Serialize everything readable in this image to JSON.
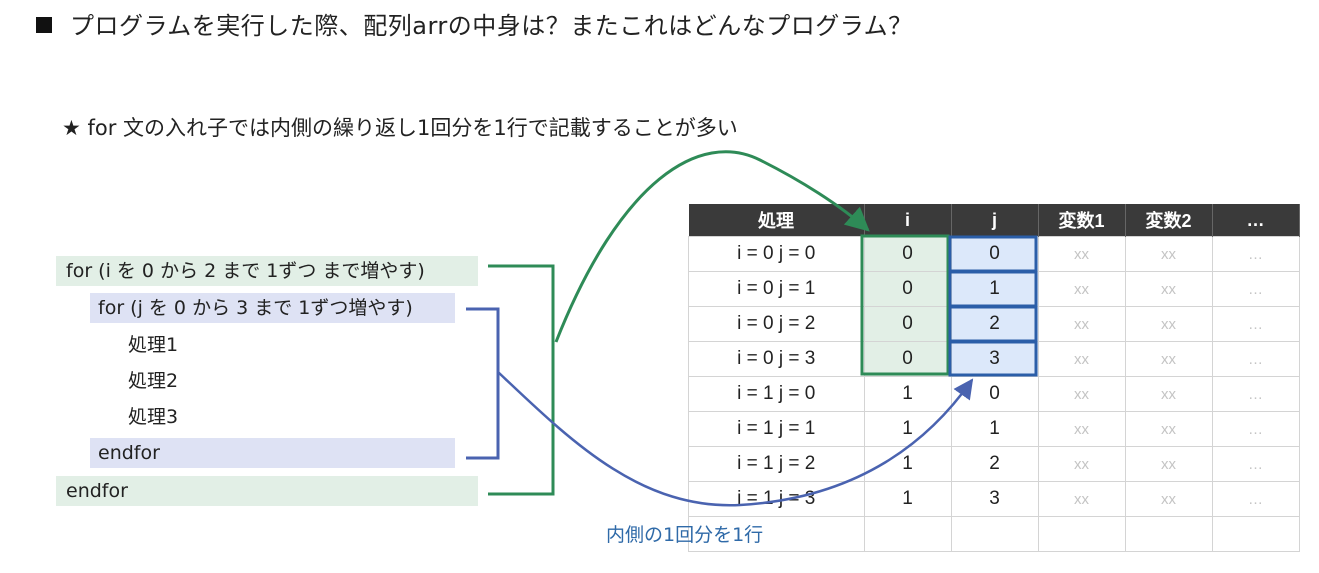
{
  "heading": "プログラムを実行した際、配列arrの中身は？またこれはどんなプログラム？",
  "note": "★ for 文の入れ子では内側の繰り返し1回分を1行で記載することが多い",
  "code": {
    "outer_for": "for (i を 0 から 2 まで 1ずつ まで増やす)",
    "inner_for": "for (j を 0 から 3 まで 1ずつ増やす)",
    "body": [
      "処理1",
      "処理2",
      "処理3"
    ],
    "inner_end": "endfor",
    "outer_end": "endfor"
  },
  "table": {
    "headers": [
      "処理",
      "i",
      "j",
      "変数1",
      "変数2",
      "…"
    ],
    "rows": [
      {
        "label": "i = 0 j = 0",
        "i": "0",
        "j": "0",
        "v1": "xx",
        "v2": "xx",
        "more": "…"
      },
      {
        "label": "i = 0 j = 1",
        "i": "0",
        "j": "1",
        "v1": "xx",
        "v2": "xx",
        "more": "…"
      },
      {
        "label": "i = 0 j = 2",
        "i": "0",
        "j": "2",
        "v1": "xx",
        "v2": "xx",
        "more": "…"
      },
      {
        "label": "i = 0 j = 3",
        "i": "0",
        "j": "3",
        "v1": "xx",
        "v2": "xx",
        "more": "…"
      },
      {
        "label": "i = 1 j = 0",
        "i": "1",
        "j": "0",
        "v1": "xx",
        "v2": "xx",
        "more": "…"
      },
      {
        "label": "i = 1 j = 1",
        "i": "1",
        "j": "1",
        "v1": "xx",
        "v2": "xx",
        "more": "…"
      },
      {
        "label": "i = 1 j = 2",
        "i": "1",
        "j": "2",
        "v1": "xx",
        "v2": "xx",
        "more": "…"
      },
      {
        "label": "i = 1 j = 3",
        "i": "1",
        "j": "3",
        "v1": "xx",
        "v2": "xx",
        "more": "…"
      }
    ]
  },
  "caption": "内側の1回分を1行",
  "colors": {
    "outer": "#2e8b57",
    "inner": "#4a63b0",
    "header_bg": "#3a3a3a"
  }
}
